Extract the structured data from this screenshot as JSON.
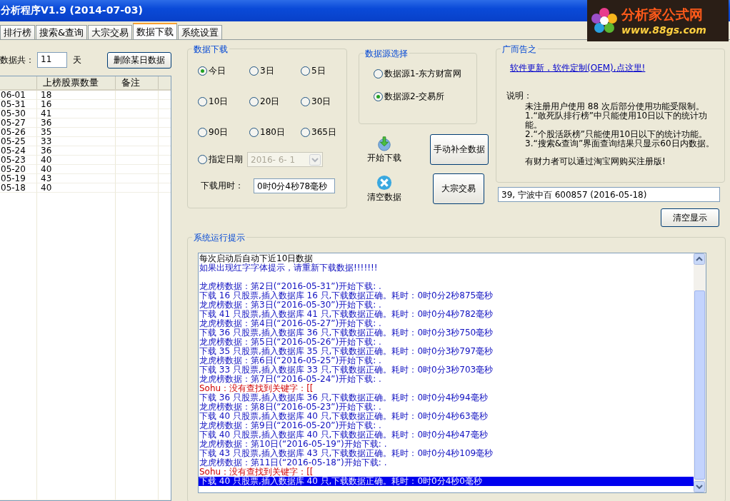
{
  "window": {
    "title": "分析程序V1.9 (2014-07-03)"
  },
  "logo": {
    "name": "分析家公式网",
    "url": "www.88gs.com"
  },
  "tabs": [
    {
      "label": "排行榜",
      "selected": false
    },
    {
      "label": "搜索&查询",
      "selected": false
    },
    {
      "label": "大宗交易",
      "selected": false
    },
    {
      "label": "数据下载",
      "selected": true
    },
    {
      "label": "系统设置",
      "selected": false
    }
  ],
  "left": {
    "count_label": "数据共：",
    "count_value": "11",
    "count_unit": "天",
    "delete_button": "删除某日数据",
    "table": {
      "columns": [
        "",
        "上榜股票数量",
        "备注"
      ],
      "rows": [
        [
          "06-01",
          "18"
        ],
        [
          "05-31",
          "16"
        ],
        [
          "05-30",
          "41"
        ],
        [
          "05-27",
          "36"
        ],
        [
          "05-26",
          "35"
        ],
        [
          "05-25",
          "33"
        ],
        [
          "05-24",
          "36"
        ],
        [
          "05-23",
          "40"
        ],
        [
          "05-20",
          "40"
        ],
        [
          "05-19",
          "43"
        ],
        [
          "05-18",
          "40"
        ]
      ]
    }
  },
  "download": {
    "title": "数据下载",
    "options": [
      {
        "label": "今日",
        "selected": true
      },
      {
        "label": "3日",
        "selected": false
      },
      {
        "label": "5日",
        "selected": false
      },
      {
        "label": "10日",
        "selected": false
      },
      {
        "label": "20日",
        "selected": false
      },
      {
        "label": "30日",
        "selected": false
      },
      {
        "label": "90日",
        "selected": false
      },
      {
        "label": "180日",
        "selected": false
      },
      {
        "label": "365日",
        "selected": false
      }
    ],
    "custom": {
      "label": "指定日期",
      "selected": false,
      "date": "2016- 6- 1",
      "disabled": true
    },
    "elapsed_label": "下载用时：",
    "elapsed_value": "0时0分4秒78毫秒"
  },
  "source": {
    "title": "数据源选择",
    "options": [
      {
        "label": "数据源1-东方财富网",
        "selected": false
      },
      {
        "label": "数据源2-交易所",
        "selected": true
      }
    ]
  },
  "actions": {
    "start": "开始下载",
    "fill": "手动补全数据",
    "clear": "清空数据",
    "block": "大宗交易"
  },
  "ad": {
    "title": "广而告之",
    "link": "软件更新，软件定制(OEM),点这里!",
    "heading": "说明：",
    "notes": [
      "未注册用户使用 88 次后部分使用功能受限制。",
      "1.“敢死队排行榜”中只能使用10日以下的统计功能。",
      "2.“个股活跃榜”只能使用10日以下的统计功能。",
      "3.“搜索&查询”界面查询结果只显示60日内数据。"
    ],
    "footer": "有财力者可以通过淘宝网购买注册版!"
  },
  "info_field": "39, 宁波中百    600857        (2016-05-18)",
  "clear_display": "清空显示",
  "log": {
    "title": "系统运行提示",
    "header_lines": [
      {
        "text": "每次启动后自动下近10日数据",
        "kind": "plain",
        "selected": false
      },
      {
        "text": "如果出现红字字体提示，请重新下载数据!!!!!!!",
        "kind": "info",
        "selected": false
      }
    ],
    "lines": [
      {
        "text": "龙虎榜数据：第2日(“2016-05-31”)开始下载: .",
        "kind": "info",
        "selected": false
      },
      {
        "text": "下载 16 只股票,插入数据库 16 只,下载数据正确。耗时：0时0分2秒875毫秒",
        "kind": "info",
        "selected": false
      },
      {
        "text": "龙虎榜数据：第3日(“2016-05-30”)开始下载: .",
        "kind": "info",
        "selected": false
      },
      {
        "text": "下载 41 只股票,插入数据库 41 只,下载数据正确。耗时：0时0分4秒782毫秒",
        "kind": "info",
        "selected": false
      },
      {
        "text": "龙虎榜数据：第4日(“2016-05-27”)开始下载: .",
        "kind": "info",
        "selected": false
      },
      {
        "text": "下载 36 只股票,插入数据库 36 只,下载数据正确。耗时：0时0分3秒750毫秒",
        "kind": "info",
        "selected": false
      },
      {
        "text": "龙虎榜数据：第5日(“2016-05-26”)开始下载: .",
        "kind": "info",
        "selected": false
      },
      {
        "text": "下载 35 只股票,插入数据库 35 只,下载数据正确。耗时：0时0分3秒797毫秒",
        "kind": "info",
        "selected": false
      },
      {
        "text": "龙虎榜数据：第6日(“2016-05-25”)开始下载: .",
        "kind": "info",
        "selected": false
      },
      {
        "text": "下载 33 只股票,插入数据库 33 只,下载数据正确。耗时：0时0分3秒703毫秒",
        "kind": "info",
        "selected": false
      },
      {
        "text": "龙虎榜数据：第7日(“2016-05-24”)开始下载: .",
        "kind": "info",
        "selected": false
      },
      {
        "text": "Sohu：没有查找到关键字：[[",
        "kind": "error",
        "selected": false
      },
      {
        "text": "下载 36 只股票,插入数据库 36 只,下载数据正确。耗时：0时0分4秒94毫秒",
        "kind": "info",
        "selected": false
      },
      {
        "text": "龙虎榜数据：第8日(“2016-05-23”)开始下载: .",
        "kind": "info",
        "selected": false
      },
      {
        "text": "下载 40 只股票,插入数据库 40 只,下载数据正确。耗时：0时0分4秒63毫秒",
        "kind": "info",
        "selected": false
      },
      {
        "text": "龙虎榜数据：第9日(“2016-05-20”)开始下载: .",
        "kind": "info",
        "selected": false
      },
      {
        "text": "下载 40 只股票,插入数据库 40 只,下载数据正确。耗时：0时0分4秒47毫秒",
        "kind": "info",
        "selected": false
      },
      {
        "text": "龙虎榜数据：第10日(“2016-05-19”)开始下载: .",
        "kind": "info",
        "selected": false
      },
      {
        "text": "下载 43 只股票,插入数据库 43 只,下载数据正确。耗时：0时0分4秒109毫秒",
        "kind": "info",
        "selected": false
      },
      {
        "text": "龙虎榜数据：第11日(“2016-05-18”)开始下载: .",
        "kind": "info",
        "selected": false
      },
      {
        "text": "Sohu：没有查找到关键字：[[",
        "kind": "error",
        "selected": false
      },
      {
        "text": "下载 40 只股票,插入数据库 40 只,下载数据正确。耗时：0时0分4秒0毫秒",
        "kind": "info",
        "selected": true
      }
    ]
  }
}
